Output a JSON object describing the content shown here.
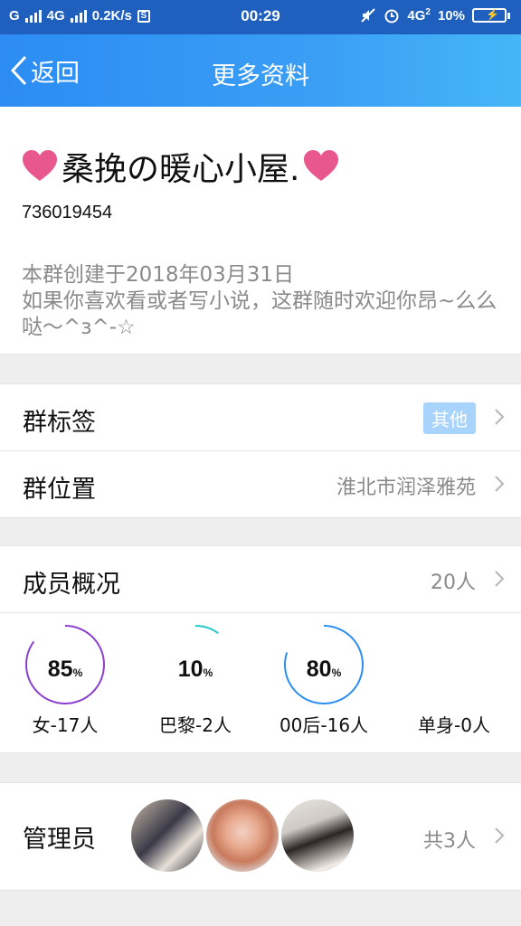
{
  "status_bar": {
    "carrier_left": "G",
    "network": "4G",
    "speed": "0.2K/s",
    "s_icon": "S",
    "time": "00:29",
    "network2": "4G",
    "network2_sub": "2",
    "battery": "10%"
  },
  "nav": {
    "back_label": "返回",
    "title": "更多资料"
  },
  "group": {
    "name": "桑挽の暖心小屋.",
    "id": "736019454",
    "created": "本群创建于2018年03月31日",
    "description": "如果你喜欢看或者写小说，这群随时欢迎你昂~么么哒～^ɜ^-☆"
  },
  "rows": {
    "tags_label": "群标签",
    "tags_value": "其他",
    "location_label": "群位置",
    "location_value": "淮北市润泽雅苑"
  },
  "members": {
    "label": "成员概况",
    "count": "20人",
    "stats": [
      {
        "value": 85,
        "sign": "%",
        "caption": "女-17人",
        "color": "#8a3fd0"
      },
      {
        "value": 10,
        "sign": "%",
        "caption": "巴黎-2人",
        "color": "#27c7c7"
      },
      {
        "value": 80,
        "sign": "%",
        "caption": "00后-16人",
        "color": "#2b8ef0"
      },
      {
        "value": null,
        "sign": "",
        "caption": "单身-0人",
        "color": "#cccccc"
      }
    ]
  },
  "admins": {
    "label": "管理员",
    "count": "共3人"
  },
  "colors": {
    "accent": "#2c8cf3",
    "heart": "#e8578d",
    "tag_bg": "#a8d3fa"
  },
  "icons": {
    "back": "chevron-left-icon",
    "row": "chevron-right-icon",
    "heart": "heart-icon"
  }
}
